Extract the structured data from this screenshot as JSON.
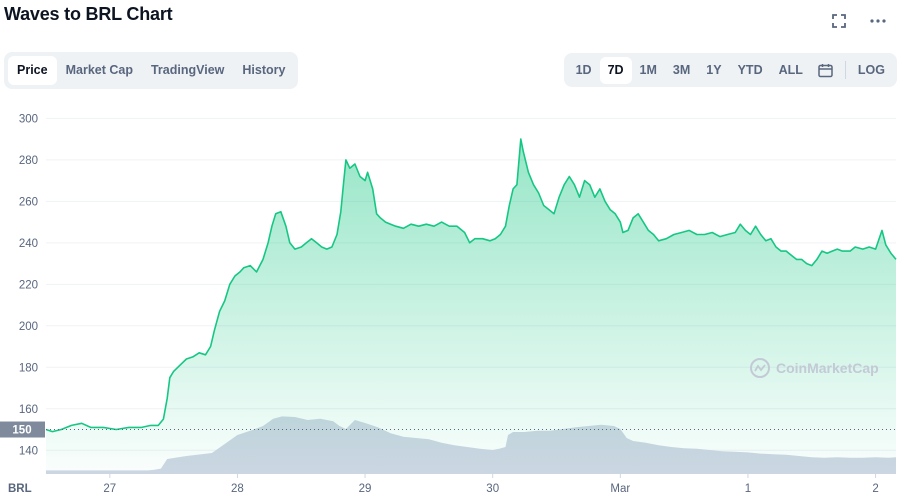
{
  "header": {
    "title": "Waves to BRL Chart"
  },
  "tabs": [
    {
      "label": "Price",
      "active": true
    },
    {
      "label": "Market Cap",
      "active": false
    },
    {
      "label": "TradingView",
      "active": false
    },
    {
      "label": "History",
      "active": false
    }
  ],
  "ranges": [
    {
      "label": "1D",
      "active": false
    },
    {
      "label": "7D",
      "active": true
    },
    {
      "label": "1M",
      "active": false
    },
    {
      "label": "3M",
      "active": false
    },
    {
      "label": "1Y",
      "active": false
    },
    {
      "label": "YTD",
      "active": false
    },
    {
      "label": "ALL",
      "active": false
    }
  ],
  "log_label": "LOG",
  "currency_label": "BRL",
  "watermark": "CoinMarketCap",
  "colors": {
    "price_line": "#16c784",
    "volume": "#cfd6e4",
    "text_muted": "#58667e"
  },
  "chart_data": {
    "type": "area",
    "ylim": [
      130,
      305
    ],
    "y_ticks": [
      140,
      160,
      180,
      200,
      220,
      240,
      260,
      280,
      300
    ],
    "x_ticks": [
      {
        "label": "27",
        "t": 0.5
      },
      {
        "label": "28",
        "t": 1.5
      },
      {
        "label": "29",
        "t": 2.5
      },
      {
        "label": "30",
        "t": 3.5
      },
      {
        "label": "Mar",
        "t": 4.5
      },
      {
        "label": "1",
        "t": 5.5
      },
      {
        "label": "2",
        "t": 6.5
      }
    ],
    "reference_price": {
      "value": 150,
      "label": "150"
    },
    "grid": true,
    "price": [
      [
        0.0,
        150
      ],
      [
        0.05,
        149
      ],
      [
        0.12,
        150
      ],
      [
        0.2,
        152
      ],
      [
        0.28,
        153
      ],
      [
        0.35,
        151
      ],
      [
        0.45,
        151
      ],
      [
        0.55,
        150
      ],
      [
        0.65,
        151
      ],
      [
        0.75,
        151
      ],
      [
        0.82,
        152
      ],
      [
        0.88,
        152
      ],
      [
        0.92,
        155
      ],
      [
        0.95,
        165
      ],
      [
        0.97,
        175
      ],
      [
        1.0,
        178
      ],
      [
        1.05,
        181
      ],
      [
        1.1,
        184
      ],
      [
        1.15,
        185
      ],
      [
        1.2,
        187
      ],
      [
        1.25,
        186
      ],
      [
        1.29,
        190
      ],
      [
        1.32,
        198
      ],
      [
        1.36,
        207
      ],
      [
        1.4,
        212
      ],
      [
        1.44,
        220
      ],
      [
        1.48,
        224
      ],
      [
        1.52,
        226
      ],
      [
        1.55,
        228
      ],
      [
        1.6,
        229
      ],
      [
        1.65,
        226
      ],
      [
        1.7,
        232
      ],
      [
        1.74,
        240
      ],
      [
        1.77,
        248
      ],
      [
        1.8,
        254
      ],
      [
        1.84,
        255
      ],
      [
        1.88,
        248
      ],
      [
        1.91,
        240
      ],
      [
        1.95,
        237
      ],
      [
        2.0,
        238
      ],
      [
        2.04,
        240
      ],
      [
        2.08,
        242
      ],
      [
        2.12,
        240
      ],
      [
        2.16,
        238
      ],
      [
        2.2,
        237
      ],
      [
        2.24,
        238
      ],
      [
        2.28,
        244
      ],
      [
        2.31,
        255
      ],
      [
        2.33,
        268
      ],
      [
        2.35,
        280
      ],
      [
        2.38,
        276
      ],
      [
        2.42,
        278
      ],
      [
        2.46,
        272
      ],
      [
        2.5,
        270
      ],
      [
        2.52,
        274
      ],
      [
        2.56,
        266
      ],
      [
        2.59,
        254
      ],
      [
        2.62,
        252
      ],
      [
        2.66,
        250
      ],
      [
        2.7,
        249
      ],
      [
        2.74,
        248
      ],
      [
        2.8,
        247
      ],
      [
        2.86,
        249
      ],
      [
        2.92,
        248
      ],
      [
        2.98,
        249
      ],
      [
        3.04,
        248
      ],
      [
        3.1,
        250
      ],
      [
        3.16,
        248
      ],
      [
        3.22,
        248
      ],
      [
        3.28,
        245
      ],
      [
        3.32,
        240
      ],
      [
        3.36,
        242
      ],
      [
        3.42,
        242
      ],
      [
        3.48,
        241
      ],
      [
        3.52,
        242
      ],
      [
        3.56,
        244
      ],
      [
        3.6,
        248
      ],
      [
        3.63,
        258
      ],
      [
        3.66,
        266
      ],
      [
        3.69,
        268
      ],
      [
        3.72,
        290
      ],
      [
        3.74,
        284
      ],
      [
        3.78,
        274
      ],
      [
        3.82,
        268
      ],
      [
        3.86,
        264
      ],
      [
        3.9,
        258
      ],
      [
        3.94,
        256
      ],
      [
        3.98,
        254
      ],
      [
        4.02,
        262
      ],
      [
        4.06,
        268
      ],
      [
        4.1,
        272
      ],
      [
        4.14,
        268
      ],
      [
        4.18,
        262
      ],
      [
        4.22,
        270
      ],
      [
        4.26,
        268
      ],
      [
        4.3,
        262
      ],
      [
        4.34,
        266
      ],
      [
        4.38,
        260
      ],
      [
        4.42,
        256
      ],
      [
        4.46,
        254
      ],
      [
        4.5,
        250
      ],
      [
        4.52,
        245
      ],
      [
        4.56,
        246
      ],
      [
        4.6,
        252
      ],
      [
        4.64,
        254
      ],
      [
        4.68,
        250
      ],
      [
        4.72,
        246
      ],
      [
        4.76,
        244
      ],
      [
        4.8,
        241
      ],
      [
        4.86,
        242
      ],
      [
        4.92,
        244
      ],
      [
        4.98,
        245
      ],
      [
        5.04,
        246
      ],
      [
        5.1,
        244
      ],
      [
        5.16,
        244
      ],
      [
        5.22,
        245
      ],
      [
        5.28,
        243
      ],
      [
        5.34,
        244
      ],
      [
        5.4,
        245
      ],
      [
        5.44,
        249
      ],
      [
        5.48,
        246
      ],
      [
        5.52,
        244
      ],
      [
        5.56,
        248
      ],
      [
        5.6,
        244
      ],
      [
        5.64,
        241
      ],
      [
        5.68,
        242
      ],
      [
        5.72,
        238
      ],
      [
        5.76,
        236
      ],
      [
        5.8,
        236
      ],
      [
        5.84,
        234
      ],
      [
        5.88,
        232
      ],
      [
        5.92,
        232
      ],
      [
        5.96,
        230
      ],
      [
        6.0,
        229
      ],
      [
        6.04,
        232
      ],
      [
        6.08,
        236
      ],
      [
        6.12,
        235
      ],
      [
        6.16,
        236
      ],
      [
        6.2,
        237
      ],
      [
        6.24,
        236
      ],
      [
        6.3,
        236
      ],
      [
        6.34,
        238
      ],
      [
        6.4,
        237
      ],
      [
        6.45,
        238
      ],
      [
        6.5,
        237
      ],
      [
        6.55,
        246
      ],
      [
        6.58,
        239
      ],
      [
        6.62,
        235
      ],
      [
        6.66,
        232
      ]
    ],
    "volume": [
      [
        0.0,
        0.06
      ],
      [
        0.5,
        0.06
      ],
      [
        0.8,
        0.06
      ],
      [
        0.85,
        0.07
      ],
      [
        0.9,
        0.09
      ],
      [
        0.95,
        0.25
      ],
      [
        1.1,
        0.3
      ],
      [
        1.3,
        0.35
      ],
      [
        1.4,
        0.5
      ],
      [
        1.5,
        0.65
      ],
      [
        1.6,
        0.72
      ],
      [
        1.7,
        0.8
      ],
      [
        1.78,
        0.92
      ],
      [
        1.85,
        0.96
      ],
      [
        1.95,
        0.95
      ],
      [
        2.05,
        0.9
      ],
      [
        2.15,
        0.92
      ],
      [
        2.25,
        0.88
      ],
      [
        2.3,
        0.8
      ],
      [
        2.35,
        0.75
      ],
      [
        2.42,
        0.9
      ],
      [
        2.5,
        0.85
      ],
      [
        2.6,
        0.78
      ],
      [
        2.7,
        0.68
      ],
      [
        2.8,
        0.62
      ],
      [
        2.9,
        0.6
      ],
      [
        3.0,
        0.58
      ],
      [
        3.1,
        0.52
      ],
      [
        3.2,
        0.48
      ],
      [
        3.3,
        0.45
      ],
      [
        3.4,
        0.42
      ],
      [
        3.5,
        0.4
      ],
      [
        3.55,
        0.42
      ],
      [
        3.6,
        0.45
      ],
      [
        3.62,
        0.65
      ],
      [
        3.66,
        0.7
      ],
      [
        3.75,
        0.7
      ],
      [
        3.85,
        0.72
      ],
      [
        3.95,
        0.72
      ],
      [
        4.05,
        0.75
      ],
      [
        4.15,
        0.78
      ],
      [
        4.25,
        0.8
      ],
      [
        4.35,
        0.82
      ],
      [
        4.45,
        0.8
      ],
      [
        4.5,
        0.75
      ],
      [
        4.55,
        0.6
      ],
      [
        4.6,
        0.55
      ],
      [
        4.7,
        0.52
      ],
      [
        4.8,
        0.48
      ],
      [
        4.9,
        0.45
      ],
      [
        5.0,
        0.43
      ],
      [
        5.1,
        0.42
      ],
      [
        5.2,
        0.4
      ],
      [
        5.3,
        0.38
      ],
      [
        5.4,
        0.37
      ],
      [
        5.5,
        0.36
      ],
      [
        5.6,
        0.34
      ],
      [
        5.7,
        0.33
      ],
      [
        5.8,
        0.32
      ],
      [
        5.9,
        0.3
      ],
      [
        6.0,
        0.28
      ],
      [
        6.1,
        0.27
      ],
      [
        6.2,
        0.28
      ],
      [
        6.3,
        0.27
      ],
      [
        6.4,
        0.27
      ],
      [
        6.5,
        0.28
      ],
      [
        6.6,
        0.27
      ],
      [
        6.66,
        0.28
      ]
    ]
  }
}
